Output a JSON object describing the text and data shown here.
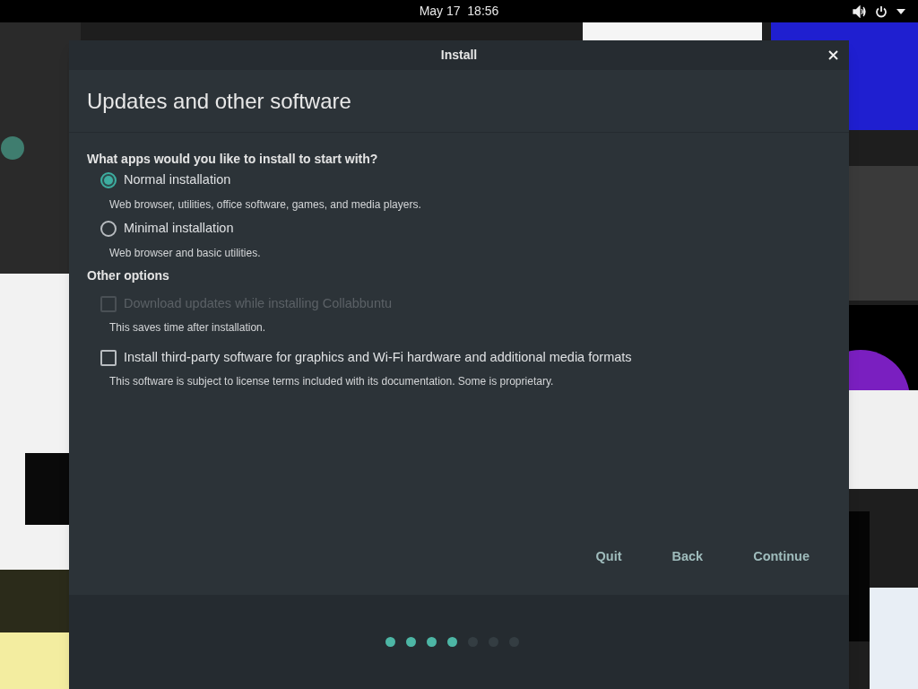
{
  "top_bar": {
    "clock": "May 17  18:56"
  },
  "window": {
    "title": "Install",
    "heading": "Updates and other software"
  },
  "apps_question": "What apps would you like to install to start with?",
  "install_options": [
    {
      "label": "Normal installation",
      "description": "Web browser, utilities, office software, games, and media players.",
      "selected": true
    },
    {
      "label": "Minimal installation",
      "description": "Web browser and basic utilities.",
      "selected": false
    }
  ],
  "other_options_heading": "Other options",
  "other_options": [
    {
      "label": "Download updates while installing Collabbuntu",
      "description": "This saves time after installation.",
      "checked": false,
      "disabled": true
    },
    {
      "label": "Install third-party software for graphics and Wi-Fi hardware and additional media formats",
      "description": "This software is subject to license terms included with its documentation. Some is proprietary.",
      "checked": false,
      "disabled": false
    }
  ],
  "buttons": [
    "Quit",
    "Back",
    "Continue"
  ],
  "progress_steps": [
    {
      "done": true
    },
    {
      "done": true
    },
    {
      "done": true
    },
    {
      "done": true
    },
    {
      "done": false
    },
    {
      "done": false
    },
    {
      "done": false
    }
  ]
}
